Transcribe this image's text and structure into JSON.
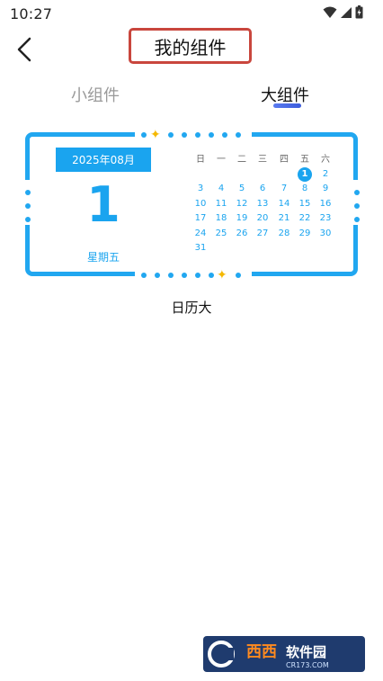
{
  "status_bar": {
    "time": "10:27"
  },
  "header": {
    "title": "我的组件"
  },
  "tabs": [
    {
      "label": "小组件",
      "active": false
    },
    {
      "label": "大组件",
      "active": true
    }
  ],
  "widget": {
    "date_label": "2025年08月",
    "day": "1",
    "weekday": "星期五",
    "week_headers": [
      "日",
      "一",
      "二",
      "三",
      "四",
      "五",
      "六"
    ],
    "first_weekday_index": 5,
    "days_in_month": 31,
    "selected_day": 1,
    "accent_color": "#1aa4ef",
    "star_color": "#f5b800",
    "name": "日历大"
  },
  "watermark": {
    "text": "西西软件园",
    "url_text": "CR173.COM"
  }
}
